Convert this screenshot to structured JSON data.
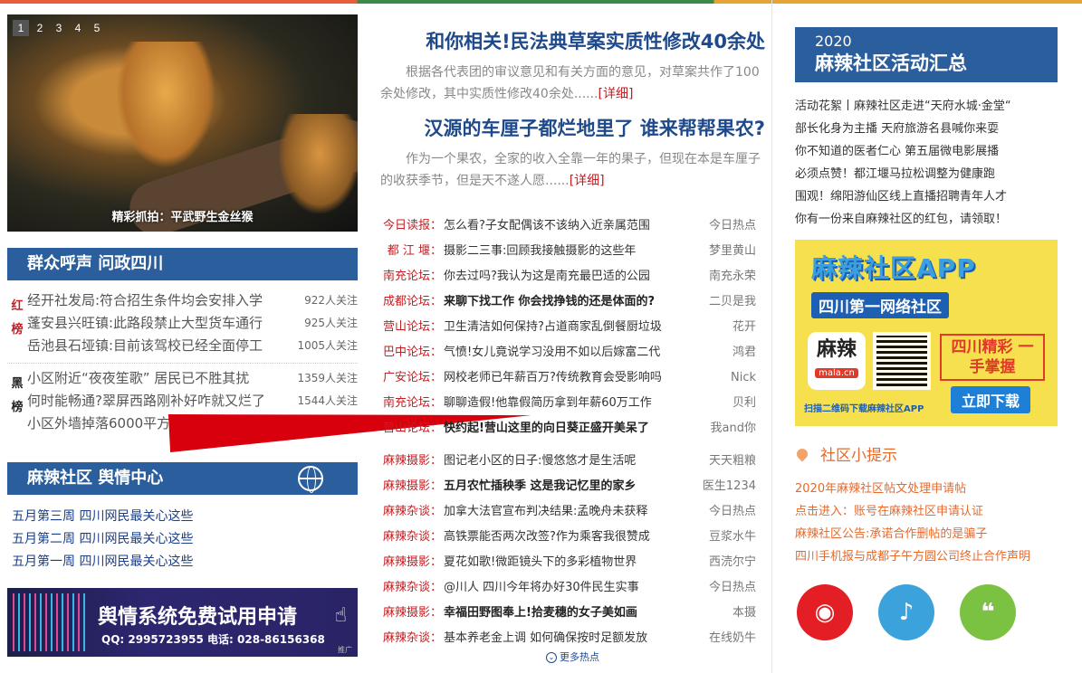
{
  "slider": {
    "dots": [
      "1",
      "2",
      "3",
      "4",
      "5"
    ],
    "active_index": 0,
    "caption": "精彩抓拍：平武野生金丝猴"
  },
  "left": {
    "section1_title": "群众呼声 问政四川",
    "red_badge": [
      "红",
      "榜"
    ],
    "black_badge": [
      "黑",
      "榜"
    ],
    "red_list": [
      {
        "title": "经开社发局:符合招生条件均会安排入学",
        "count": "922人关注"
      },
      {
        "title": "蓬安县兴旺镇:此路段禁止大型货车通行",
        "count": "925人关注"
      },
      {
        "title": "岳池县石垭镇:目前该驾校已经全面停工",
        "count": "1005人关注"
      }
    ],
    "black_list": [
      {
        "title": "小区附近“夜夜笙歌” 居民已不胜其扰",
        "count": "1359人关注"
      },
      {
        "title": "何时能畅通?翠屏西路刚补好咋就又烂了",
        "count": "1544人关注"
      },
      {
        "title": "小区外墙掉落6000平方米",
        "count": ""
      }
    ],
    "section2_title": "麻辣社区 舆情中心",
    "weeks": [
      "五月第三周 四川网民最关心这些",
      "五月第二周 四川网民最关心这些",
      "五月第一周 四川网民最关心这些"
    ],
    "banner": {
      "title": "舆情系统免费试用申请",
      "sub": "QQ: 2995723955 电话: 028-86156368",
      "tag": "推广"
    }
  },
  "mid": {
    "headline1": "和你相关!民法典草案实质性修改40余处",
    "lead1": "根据各代表团的审议意见和有关方面的意见，对草案共作了100余处修改，其中实质性修改40余处......",
    "lead1_more": "[详细]",
    "headline2": "汉源的车厘子都烂地里了 谁来帮帮果农?",
    "lead2": "作为一个果农，全家的收入全靠一年的果子，但现在本是车厘子的收获季节，但是天不遂人愿......",
    "lead2_more": "[详细]",
    "news1": [
      {
        "cat": "今日读报：",
        "title": "怎么看?子女配偶该不该纳入近亲属范围",
        "author": "今日热点",
        "bold": false
      },
      {
        "cat": "都 江 堰：",
        "title": "摄影二三事:回顾我接触摄影的这些年",
        "author": "梦里黄山",
        "bold": false
      },
      {
        "cat": "南充论坛：",
        "title": "你去过吗?我认为这是南充最巴适的公园",
        "author": "南充永荣",
        "bold": false
      },
      {
        "cat": "成都论坛：",
        "title": "来聊下找工作 你会找挣钱的还是体面的?",
        "author": "二贝是我",
        "bold": true
      },
      {
        "cat": "营山论坛：",
        "title": "卫生清洁如何保持?占道商家乱倒餐厨垃圾",
        "author": "花开",
        "bold": false
      },
      {
        "cat": "巴中论坛：",
        "title": "气愤!女儿竟说学习没用不如以后嫁富二代",
        "author": "鸿君",
        "bold": false
      },
      {
        "cat": "广安论坛：",
        "title": "网校老师已年薪百万?传统教育会受影响吗",
        "author": "Nick",
        "bold": false
      },
      {
        "cat": "南充论坛：",
        "title": "聊聊造假!他靠假简历拿到年薪60万工作",
        "author": "贝利",
        "bold": false
      },
      {
        "cat": "营山论坛：",
        "title": "快约起!营山这里的向日葵正盛开美呆了",
        "author": "我and你",
        "bold": true
      }
    ],
    "news2": [
      {
        "cat": "麻辣摄影：",
        "title": "图记老小区的日子:慢悠悠才是生活呢",
        "author": "天天粗粮",
        "bold": false
      },
      {
        "cat": "麻辣摄影：",
        "title": "五月农忙插秧季 这是我记忆里的家乡",
        "author": "医生1234",
        "bold": true
      },
      {
        "cat": "麻辣杂谈：",
        "title": "加拿大法官宣布判决结果:孟晚舟未获释",
        "author": "今日热点",
        "bold": false
      },
      {
        "cat": "麻辣杂谈：",
        "title": "高铁票能否两次改签?作为乘客我很赞成",
        "author": "豆浆水牛",
        "bold": false
      },
      {
        "cat": "麻辣摄影：",
        "title": "夏花如歌!微距镜头下的多彩植物世界",
        "author": "西涜尔宁",
        "bold": false
      },
      {
        "cat": "麻辣杂谈：",
        "title": "@川人 四川今年将办好30件民生实事",
        "author": "今日热点",
        "bold": false
      },
      {
        "cat": "麻辣摄影：",
        "title": "幸福田野图奉上!拾麦穗的女子美如画",
        "author": "本摄",
        "bold": true
      },
      {
        "cat": "麻辣杂谈：",
        "title": "基本养老金上调 如何确保按时足额发放",
        "author": "在线奶牛",
        "bold": false
      }
    ],
    "more_hot": "更多热点"
  },
  "right": {
    "act_year": "2020",
    "act_name": "麻辣社区活动汇总",
    "activities": [
      "活动花絮丨麻辣社区走进“天府水城·金堂“",
      "部长化身为主播 天府旅游名县喊你来耍",
      "你不知道的医者仁心 第五届微电影展播",
      "必须点赞！都江堰马拉松调整为健康跑",
      "围观！绵阳游仙区线上直播招聘青年人才",
      "你有一份来自麻辣社区的红包，请领取！"
    ],
    "app": {
      "title": "麻辣社区APP",
      "subtitle": "四川第一网络社区",
      "icon_text": "麻辣",
      "icon_url": "mala.cn",
      "slogan": "四川精彩 一手掌握",
      "tip": "扫描二维码下载麻辣社区APP",
      "download": "立即下载"
    },
    "tips_title": "社区小提示",
    "tips": [
      "2020年麻辣社区帖文处理申请帖",
      "点击进入：账号在麻辣社区申请认证",
      "麻辣社区公告:承诺合作删帖的是骗子",
      "四川手机报与成都子午方圆公司终止合作声明"
    ],
    "social": [
      "weibo-icon",
      "qq-icon",
      "wechat-icon"
    ]
  },
  "colors": {
    "accent_blue": "#2b5e9c",
    "accent_red": "#c41e23",
    "tip_orange": "#e66a2c"
  }
}
